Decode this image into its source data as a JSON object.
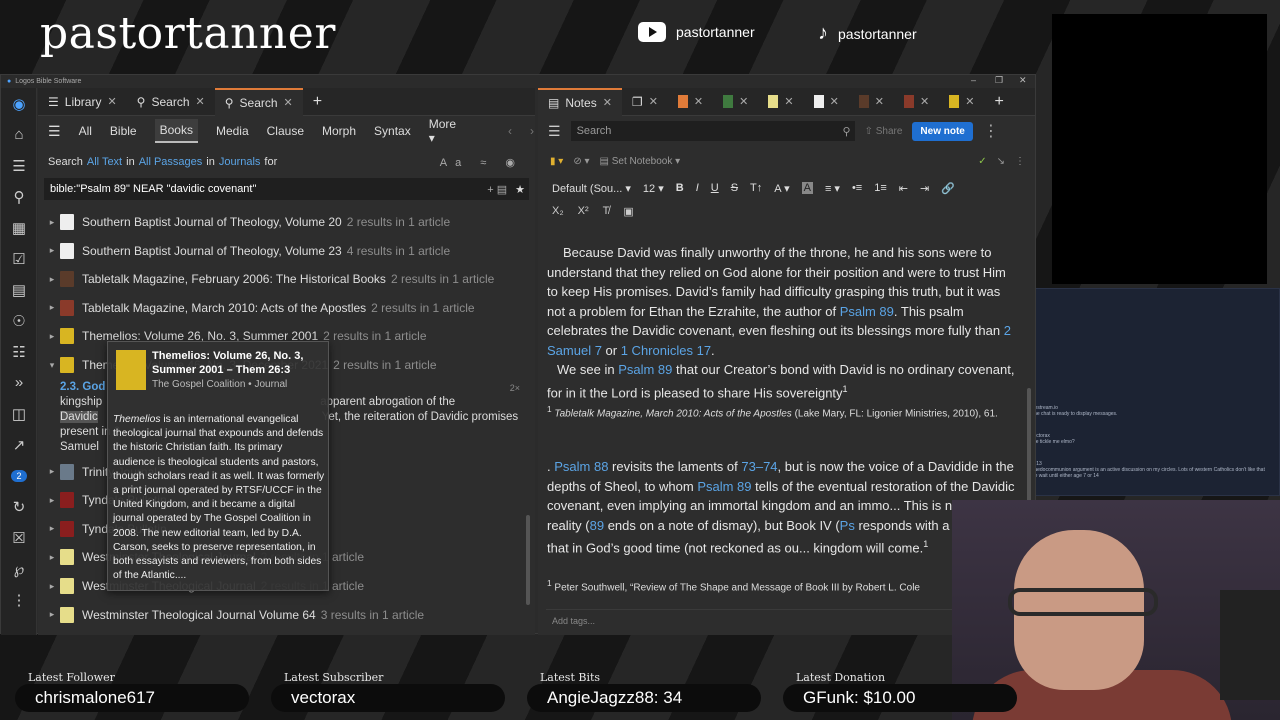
{
  "stream": {
    "brand": "pastortanner",
    "youtube_handle": "pastortanner",
    "tiktok_handle": "pastortanner",
    "labels": {
      "follower": "Latest Follower",
      "subscriber": "Latest Subscriber",
      "bits": "Latest Bits",
      "donation": "Latest Donation"
    },
    "values": {
      "follower": "chrismalone617",
      "subscriber": "vectorax",
      "bits": "AngieJagzz88: 34",
      "donation": "GFunk: $10.00"
    },
    "chat": [
      {
        "user": "Restream.io",
        "text": "The chat is ready to display messages."
      },
      {
        "user": "vectorax",
        "text": "like tickle me elmo?"
      },
      {
        "user": "ac13",
        "text": "Paedocommunion argument is an active discussion on my circles. Lots of western Catholics don't like that we wait until either age 7 or 14"
      }
    ]
  },
  "app": {
    "title": "Logos Bible Software",
    "left_tabs": [
      {
        "label": "Library"
      },
      {
        "label": "Search"
      },
      {
        "label": "Search"
      }
    ],
    "filters": [
      "All",
      "Bible",
      "Books",
      "Media",
      "Clause",
      "Morph",
      "Syntax",
      "More"
    ],
    "search_line": {
      "prefix": "Search",
      "scope1": "All Text",
      "in1": "in",
      "scope2": "All Passages",
      "in2": "in",
      "scope3": "Journals",
      "suffix": "for"
    },
    "query": "bible:\"Psalm 89\" NEAR \"davidic covenant\"",
    "results": [
      {
        "title": "Southern Baptist Journal of Theology, Volume 20",
        "count": "2 results in 1 article",
        "color": "#eeeeee"
      },
      {
        "title": "Southern Baptist Journal of Theology, Volume 23",
        "count": "4 results in 1 article",
        "color": "#eeeeee"
      },
      {
        "title": "Tabletalk Magazine, February 2006: The Historical Books",
        "count": "2 results in 1 article",
        "color": "#5a3b2a"
      },
      {
        "title": "Tabletalk Magazine, March 2010: Acts of the Apostles",
        "count": "2 results in 1 article",
        "color": "#8a3a2a"
      },
      {
        "title": "Themelios: Volume 26, No. 3, Summer 2001",
        "count": "2 results in 1 article",
        "color": "#d8b522"
      },
      {
        "title": "Themelios: Volume 46, No. 3, December 2021",
        "count": "2 results in 1 article",
        "color": "#d8b522"
      }
    ],
    "expanded": {
      "heading": "2.3. God",
      "line1a": "kingship",
      "line1b": "apparent abrogation of the",
      "line2a": "Davidic",
      "line2b": "Yet, the reiteration of Davidic promises present in 2",
      "line3a": "Samuel",
      "badge": "2×"
    },
    "results_after": [
      {
        "title": "Trinity Journal",
        "count": "",
        "color": "#6a7a8a"
      },
      {
        "title": "Tyndale Bulletin",
        "count": "",
        "color": "#8a1e1e"
      },
      {
        "title": "Tyndale Bulletin",
        "count": "",
        "color": "#8a1e1e"
      },
      {
        "title": "Westminster Theological Journal",
        "count": "2 results in 1 article",
        "color": "#e6dd8a"
      },
      {
        "title": "Westminster Theological Journal",
        "count": "2 results in 1 article",
        "color": "#e6dd8a"
      },
      {
        "title": "Westminster Theological Journal Volume 64",
        "count": "3 results in 1 article",
        "color": "#e6dd8a"
      }
    ],
    "popup": {
      "title": "Themelios: Volume 26, No. 3, Summer 2001 – Them 26:3",
      "publisher": "The Gospel Coalition",
      "type": "Journal",
      "desc_title": "Themelios",
      "description": "is an international evangelical theological journal that expounds and defends the historic Christian faith. Its primary audience is theological students and pastors, though scholars read it as well. It was formerly a print journal operated by RTSF/UCCF in the United Kingdom, and it became a digital journal operated by The Gospel Coalition in 2008. The new editorial team, led by D.A. Carson, seeks to preserve representation, in both essayists and reviewers, from both sides of the Atlantic...."
    },
    "notes": {
      "tab_label": "Notes",
      "search_placeholder": "Search",
      "share_label": "Share",
      "new_note_label": "New note",
      "notebook_label": "Set Notebook",
      "font_name": "Default (Sou...",
      "font_size": "12",
      "add_tags": "Add tags...",
      "para1": [
        {
          "t": "Because David was finally unworthy of the throne, he and his sons were to understand that they relied on God alone for their position and were to trust Him to keep His promises. David’s family had difficulty grasping this truth, but it was not a problem for Ethan the Ezrahite, the author of "
        },
        {
          "t": "Psalm 89",
          "link": true
        },
        {
          "t": ". This psalm celebrates the Davidic covenant, even fleshing out its blessings more fully than "
        },
        {
          "t": "2 Samuel 7",
          "link": true
        },
        {
          "t": " or "
        },
        {
          "t": "1 Chronicles 17",
          "link": true
        },
        {
          "t": "."
        }
      ],
      "para2": [
        {
          "t": "We see in "
        },
        {
          "t": "Psalm 89",
          "link": true
        },
        {
          "t": " that our Creator’s bond with David is no ordinary covenant, for in it the Lord is pleased to share His sovereignty"
        }
      ],
      "footnote1_source": "Tabletalk Magazine, March 2010: Acts of the Apostles",
      "footnote1_rest": "(Lake Mary, FL: Ligonier Ministries, 2010), 61.",
      "para3": [
        {
          "t": ". "
        },
        {
          "t": "Psalm 88",
          "link": true
        },
        {
          "t": " revisits the laments of "
        },
        {
          "t": "73–74",
          "link": true
        },
        {
          "t": ", but is now the voice of a Davidide in the depths of Sheol, to whom "
        },
        {
          "t": "Psalm 89",
          "link": true
        },
        {
          "t": " tells of the eventual restoration of the Davidic covenant, even implying an immortal kingdom and an immo... This is not yet a reality ("
        },
        {
          "t": "89",
          "link": true
        },
        {
          "t": " ends on a note of dismay), but Book IV ("
        },
        {
          "t": "Ps",
          "link": true
        },
        {
          "t": " responds with a promise that in God’s good time (not reckoned as ou... kingdom will come."
        }
      ],
      "footnote2": "Peter Southwell, “Review of The Shape and Message of Book III by Robert L. Cole"
    }
  }
}
